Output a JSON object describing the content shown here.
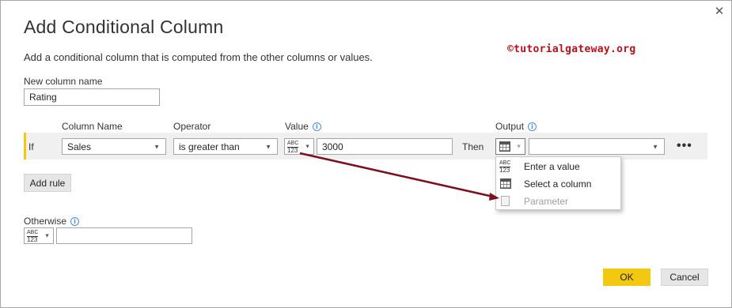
{
  "dialog": {
    "title": "Add Conditional Column",
    "subtitle": "Add a conditional column that is computed from the other columns or values.",
    "watermark": "©tutorialgateway.org",
    "close_glyph": "✕"
  },
  "new_column": {
    "label": "New column name",
    "value": "Rating"
  },
  "headers": {
    "column_name": "Column Name",
    "operator": "Operator",
    "value": "Value",
    "output": "Output",
    "info_glyph": "i"
  },
  "rule": {
    "if_label": "If",
    "column_name": "Sales",
    "operator": "is greater than",
    "value_type_top": "ABC",
    "value_type_bottom": "123",
    "value": "3000",
    "then_label": "Then",
    "output_value": "",
    "more_glyph": "•••"
  },
  "output_menu": {
    "items": [
      {
        "label": "Enter a value",
        "icon": "abc-123-icon",
        "enabled": true,
        "icon_top": "ABC",
        "icon_bottom": "123"
      },
      {
        "label": "Select a column",
        "icon": "table-column-icon",
        "enabled": true
      },
      {
        "label": "Parameter",
        "icon": "parameter-icon",
        "enabled": false
      }
    ]
  },
  "buttons": {
    "add_rule": "Add rule",
    "ok": "OK",
    "cancel": "Cancel"
  },
  "otherwise": {
    "label": "Otherwise",
    "type_top": "ABC",
    "type_bottom": "123",
    "value": ""
  },
  "colors": {
    "accent": "#f2c811",
    "arrow": "#7a1020",
    "watermark": "#b5121b",
    "info": "#4a8bd4"
  }
}
